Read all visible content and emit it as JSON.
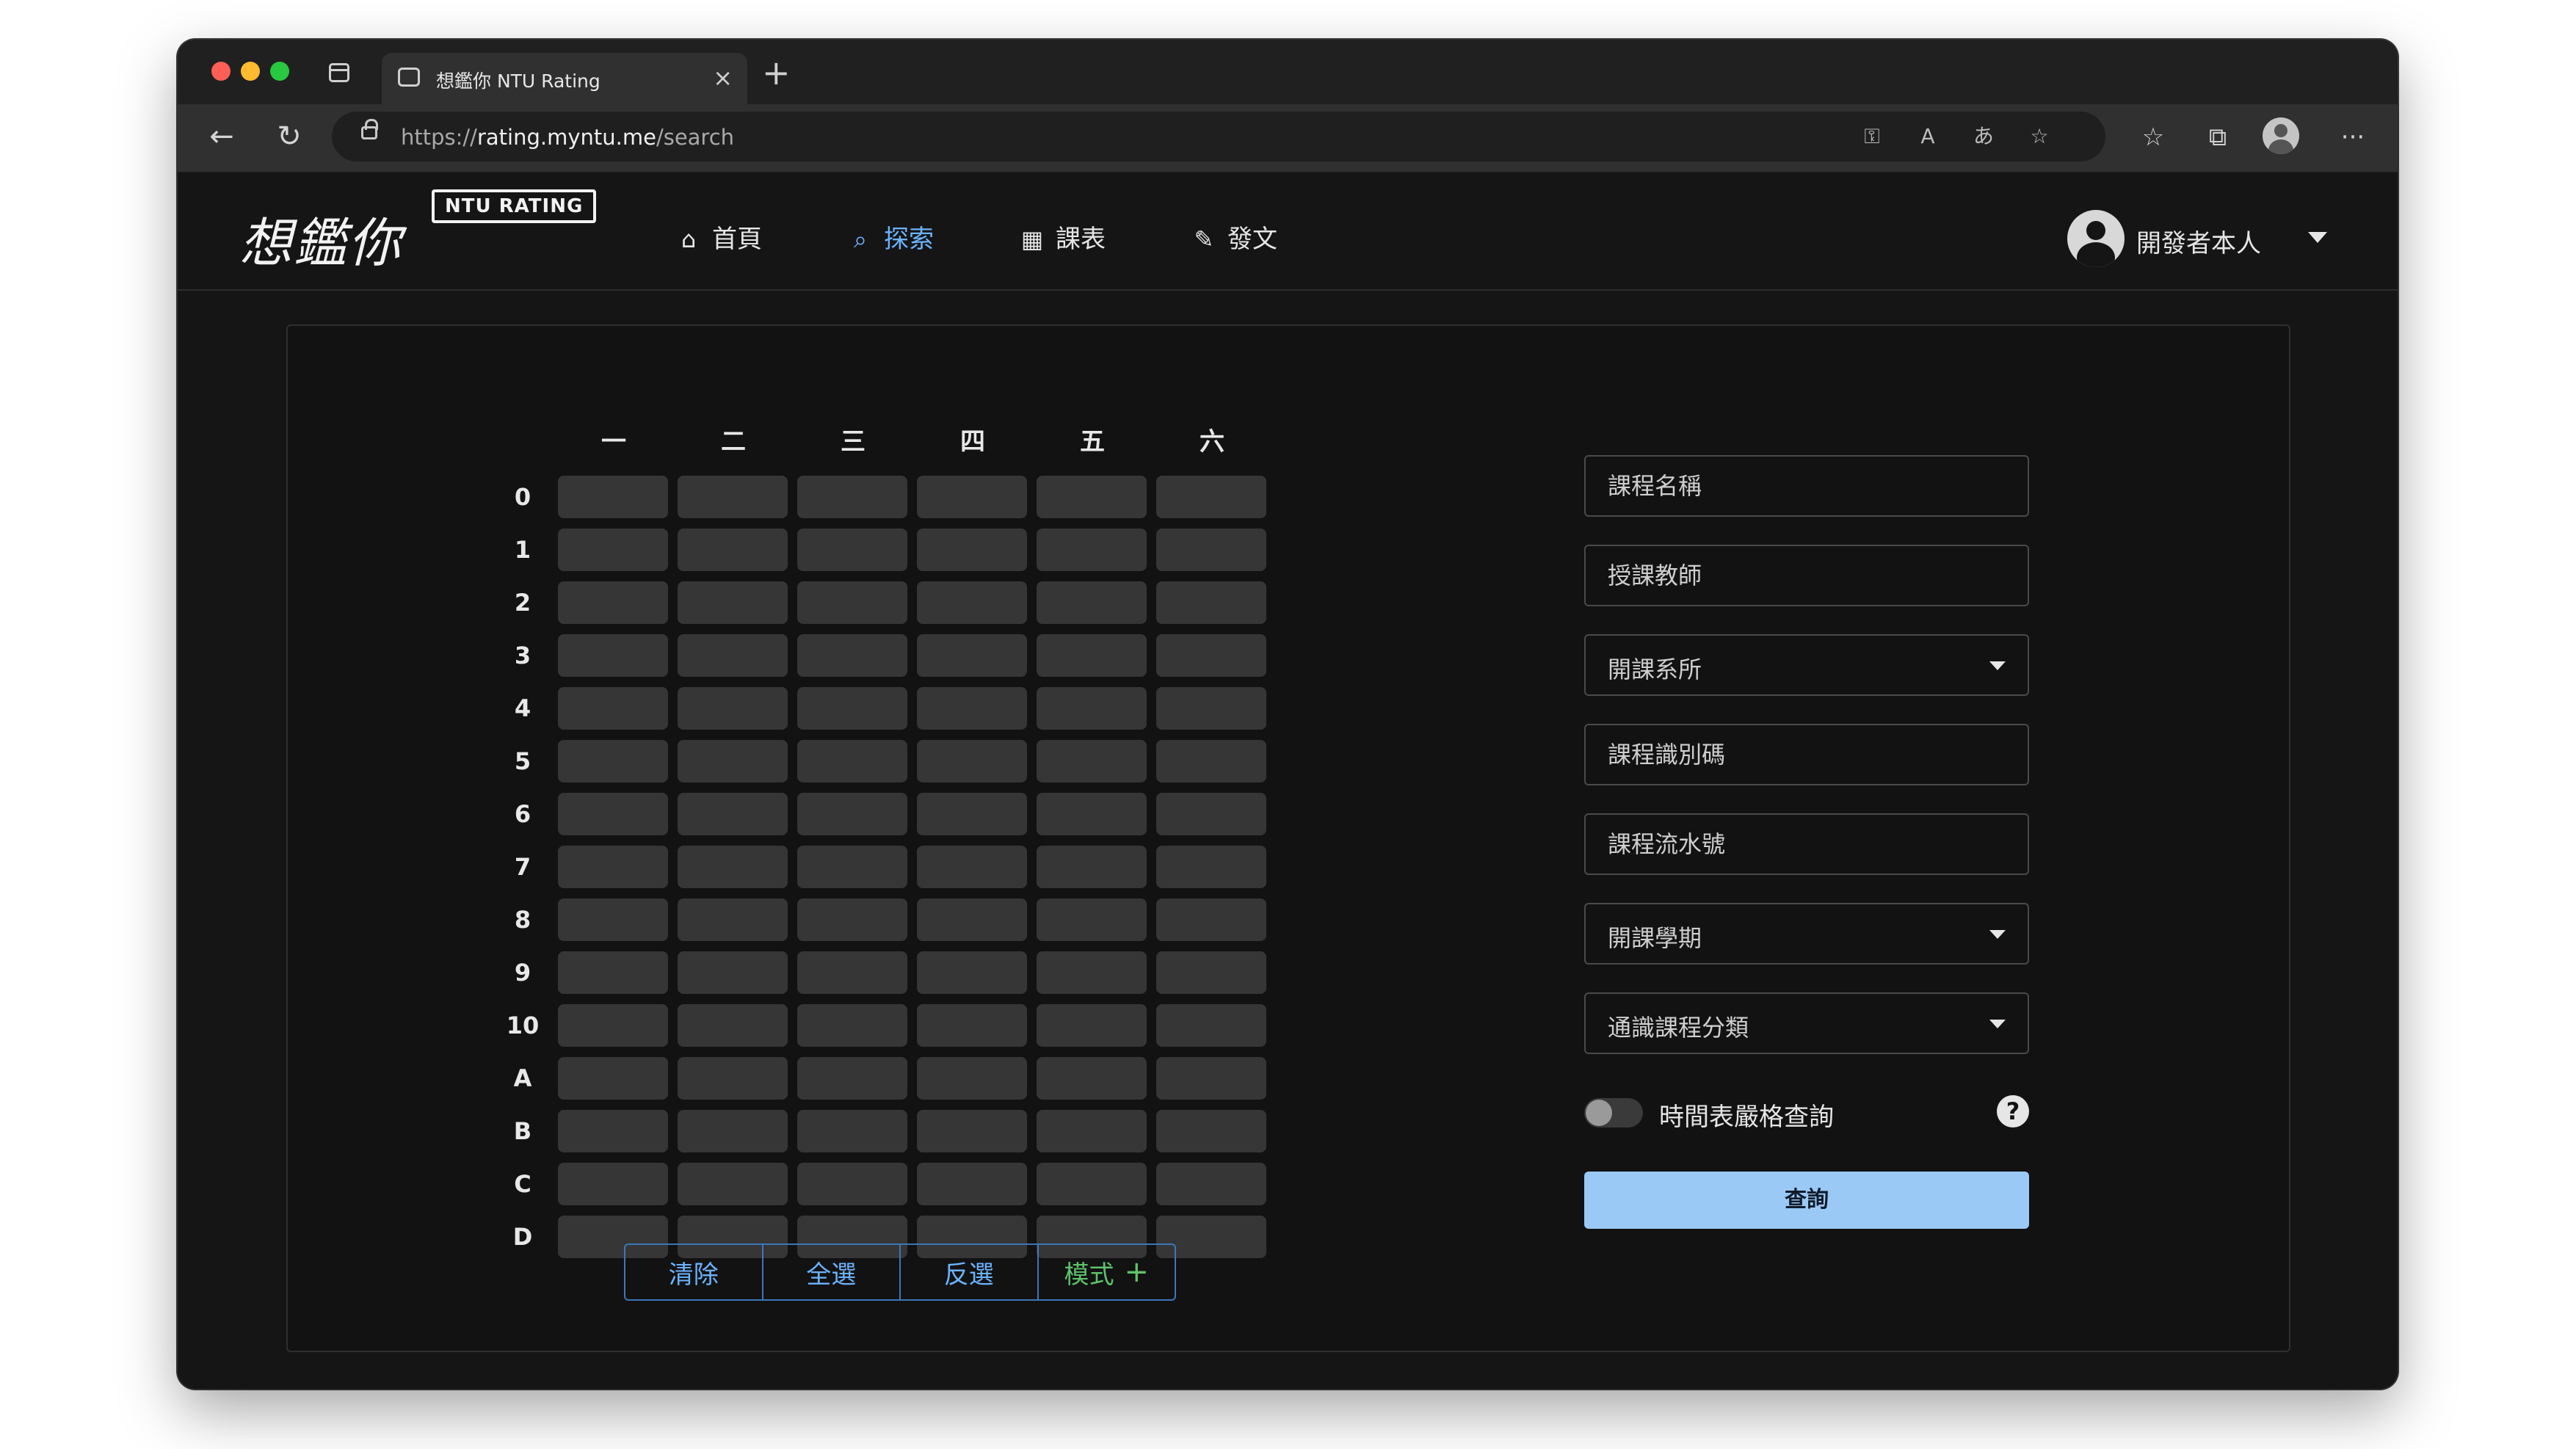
{
  "browser": {
    "tab_title": "想鑑你 NTU Rating",
    "tab_close": "×",
    "new_tab": "+",
    "url_prefix": "https://",
    "url_host": "rating.myntu.me",
    "url_path": "/search",
    "back": "←",
    "reload": "↻",
    "more": "···",
    "icons": [
      "key-icon",
      "read-aloud-icon",
      "translate-icon",
      "add-favorite-icon",
      "favorites-icon",
      "collections-icon",
      "profile-icon",
      "more-icon"
    ],
    "read_aloud": "A",
    "translate": "あ",
    "add_favorite": "☆",
    "favorites": "☆",
    "collections": "⧉"
  },
  "site": {
    "logo_text": "想鑑你",
    "logo_badge": "NTU RATING",
    "nav": [
      {
        "label": "首頁",
        "icon": "⌂",
        "active": false
      },
      {
        "label": "探索",
        "icon": "⌕",
        "active": true
      },
      {
        "label": "課表",
        "icon": "▦",
        "active": false
      },
      {
        "label": "發文",
        "icon": "✎",
        "active": false
      }
    ],
    "user_name": "開發者本人",
    "accent": "#6cb3ff"
  },
  "timetable": {
    "days": [
      "一",
      "二",
      "三",
      "四",
      "五",
      "六"
    ],
    "periods": [
      "0",
      "1",
      "2",
      "3",
      "4",
      "5",
      "6",
      "7",
      "8",
      "9",
      "10",
      "A",
      "B",
      "C",
      "D"
    ],
    "buttons": {
      "clear": "清除",
      "select_all": "全選",
      "invert": "反選",
      "mode": "模式",
      "mode_plus": "+"
    }
  },
  "search_form": {
    "course_name_placeholder": "課程名稱",
    "teacher_placeholder": "授課教師",
    "department_select": "開課系所",
    "course_id_placeholder": "課程識別碼",
    "serial_placeholder": "課程流水號",
    "semester_select": "開課學期",
    "general_ed_select": "通識課程分類",
    "strict_toggle_label": "時間表嚴格查詢",
    "strict_toggle_on": false,
    "help": "?",
    "submit": "查詢",
    "submit_color": "#9ac9f5"
  }
}
